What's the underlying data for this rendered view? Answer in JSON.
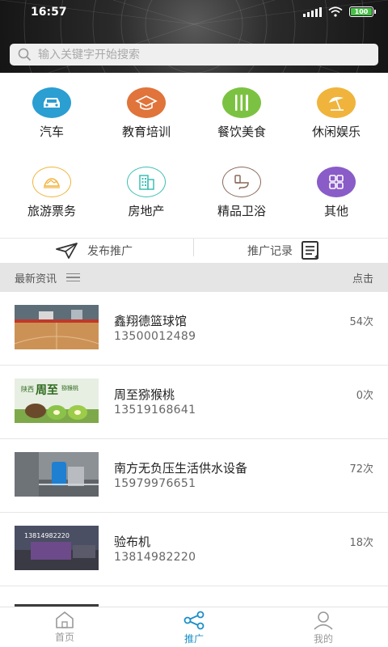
{
  "status_bar": {
    "time": "16:57",
    "battery": "100"
  },
  "search": {
    "placeholder": "输入关键字开始搜索"
  },
  "categories": [
    {
      "label": "汽车",
      "icon": "car-icon",
      "color": "#2b9ed2"
    },
    {
      "label": "教育培训",
      "icon": "graduation-cap-icon",
      "color": "#e0743a"
    },
    {
      "label": "餐饮美食",
      "icon": "cutlery-icon",
      "color": "#7cc242"
    },
    {
      "label": "休闲娱乐",
      "icon": "beach-umbrella-icon",
      "color": "#f0b43c"
    },
    {
      "label": "旅游票务",
      "icon": "travel-icon",
      "color": "#f0b43c"
    },
    {
      "label": "房地产",
      "icon": "building-icon",
      "color": "#3cbfb4"
    },
    {
      "label": "精品卫浴",
      "icon": "toilet-icon",
      "color": "#8a6a5c"
    },
    {
      "label": "其他",
      "icon": "grid-icon",
      "color": "#8a5cc8"
    }
  ],
  "actions": {
    "publish": "发布推广",
    "records": "推广记录"
  },
  "section": {
    "title": "最新资讯",
    "clicks": "点击"
  },
  "items": [
    {
      "name": "鑫翔德篮球馆",
      "phone": "13500012489",
      "count": "54次"
    },
    {
      "name": "周至猕猴桃",
      "phone": "13519168641",
      "count": "0次"
    },
    {
      "name": "南方无负压生活供水设备",
      "phone": "15979976651",
      "count": "72次"
    },
    {
      "name": "验布机",
      "phone": "13814982220",
      "count": "18次"
    }
  ],
  "thumb_text": {
    "kiwi_a": "陕西",
    "kiwi_b": "周至",
    "kiwi_c": "猕猴桃",
    "machine": "13814982220"
  },
  "nav": [
    {
      "label": "首页",
      "icon": "home-icon"
    },
    {
      "label": "推广",
      "icon": "share-icon"
    },
    {
      "label": "我的",
      "icon": "user-icon"
    }
  ],
  "colors": {
    "accent": "#1a8fc7"
  }
}
